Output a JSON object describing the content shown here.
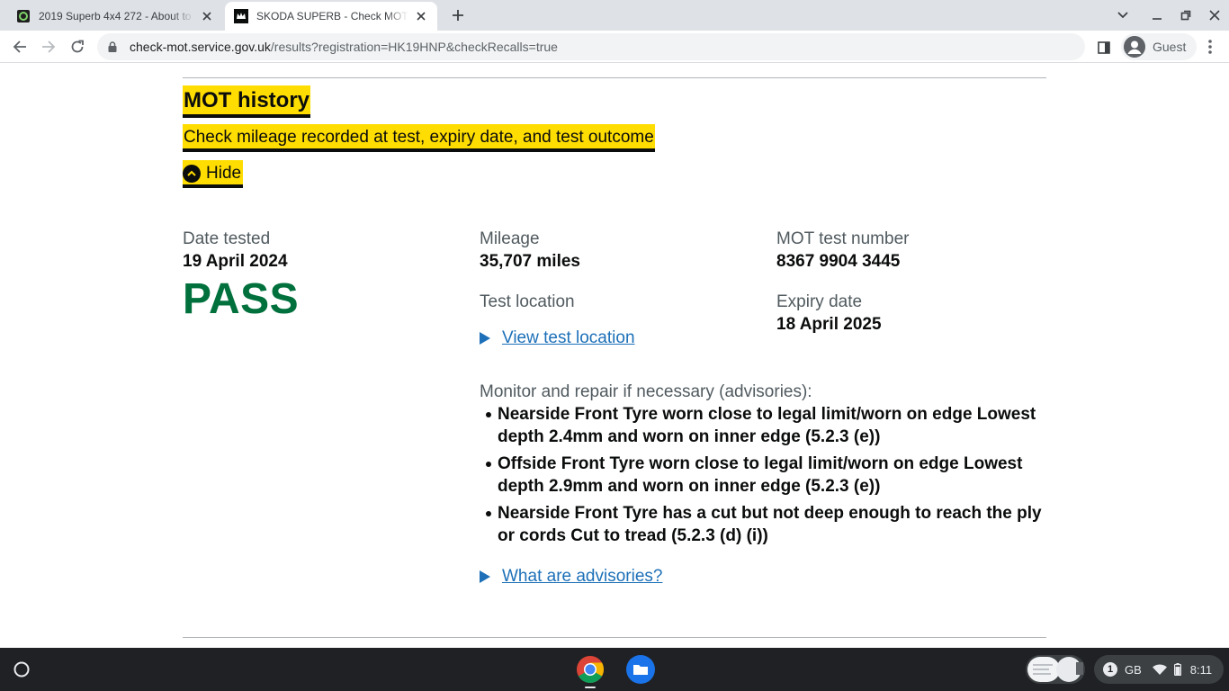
{
  "browser": {
    "tabs": [
      {
        "title": "2019 Superb 4x4 272 - About to",
        "active": false
      },
      {
        "title": "SKODA SUPERB - Check MOT his",
        "active": true
      }
    ],
    "url_host": "check-mot.service.gov.uk",
    "url_path": "/results?registration=HK19HNP&checkRecalls=true",
    "profile_label": "Guest"
  },
  "mot": {
    "heading": "MOT history",
    "subheading": "Check mileage recorded at test, expiry date, and test outcome",
    "toggle_label": "Hide",
    "date_tested_label": "Date tested",
    "date_tested": "19 April 2024",
    "result": "PASS",
    "mileage_label": "Mileage",
    "mileage": "35,707 miles",
    "test_location_label": "Test location",
    "view_location_link": "View test location",
    "test_number_label": "MOT test number",
    "test_number": "8367 9904 3445",
    "expiry_label": "Expiry date",
    "expiry_date": "18 April 2025",
    "advisories_label": "Monitor and repair if necessary (advisories):",
    "advisories": [
      "Nearside Front Tyre worn close to legal limit/worn on edge Lowest depth 2.4mm and worn on inner edge (5.2.3 (e))",
      "Offside Front Tyre worn close to legal limit/worn on edge Lowest depth 2.9mm and worn on inner edge (5.2.3 (e))",
      "Nearside Front Tyre has a cut but not deep enough to reach the ply or cords Cut to tread (5.2.3 (d) (i))"
    ],
    "advisories_link": "What are advisories?"
  },
  "shelf": {
    "tray_notification_count": "1",
    "keyboard_layout": "GB",
    "time": "8:11"
  },
  "colors": {
    "pass_green": "#00703c",
    "link_blue": "#1d70b8",
    "focus_yellow": "#ffdd00"
  }
}
